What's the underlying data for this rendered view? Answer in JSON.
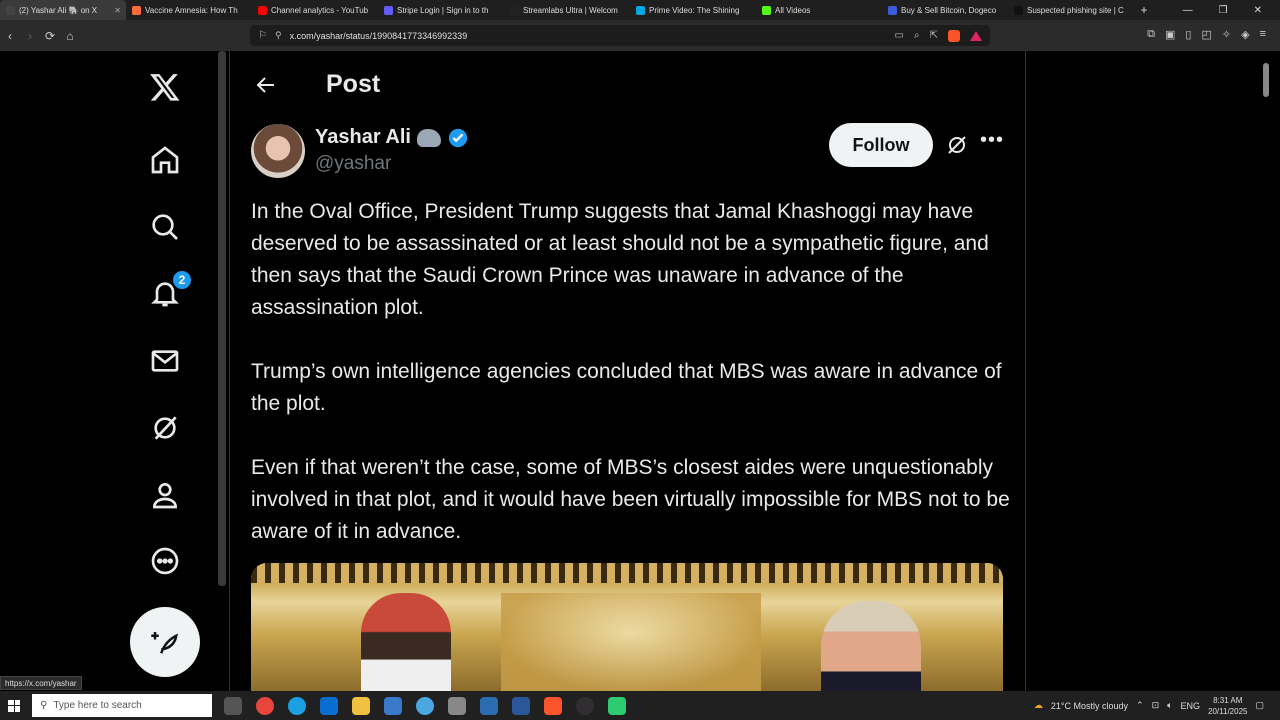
{
  "browser": {
    "tabs": [
      {
        "label": "(2) Yashar Ali 🐘 on X",
        "color": "#444444",
        "active": true
      },
      {
        "label": "Vaccine Amnesia: How Th",
        "color": "#ff6a3d"
      },
      {
        "label": "Channel analytics - YouTub",
        "color": "#ff0000"
      },
      {
        "label": "Stripe Login | Sign in to th",
        "color": "#635bff"
      },
      {
        "label": "Streamlabs Ultra | Welcom",
        "color": "#222222"
      },
      {
        "label": "Prime Video: The Shining",
        "color": "#00a8e1"
      },
      {
        "label": "All Videos",
        "color": "#53fc18"
      },
      {
        "label": "Buy & Sell Bitcoin, Dogeco",
        "color": "#3b5bdb"
      },
      {
        "label": "Suspected phishing site | C",
        "color": "#111111"
      }
    ],
    "new_tab": "+",
    "url": "x.com/yashar/status/1990841773346992339",
    "status_url": "https://x.com/yashar"
  },
  "page": {
    "title": "Post",
    "author": {
      "name": "Yashar Ali",
      "handle": "@yashar"
    },
    "follow_label": "Follow",
    "more_label": "•••",
    "notifications_count": "2",
    "paragraphs": [
      "In the Oval Office, President Trump suggests that Jamal Khashoggi may have deserved to be assassinated or at least should not be a sympathetic figure, and then says that the Saudi Crown Prince was unaware in advance of the assassination plot.",
      "Trump’s own intelligence agencies concluded that MBS was aware in advance of the plot.",
      "Even if that weren’t the case, some of MBS’s closest aides were unquestionably involved in that plot, and it would have been virtually impossible for MBS not to be aware of it in advance."
    ]
  },
  "taskbar": {
    "search_placeholder": "Type here to search",
    "weather": "21°C  Mostly cloudy",
    "language": "ENG",
    "time": "8:31 AM",
    "date": "20/11/2025"
  },
  "colors": {
    "accent": "#1d9bf0",
    "background": "#000000",
    "text": "#e7e9ea",
    "muted": "#71767b"
  }
}
